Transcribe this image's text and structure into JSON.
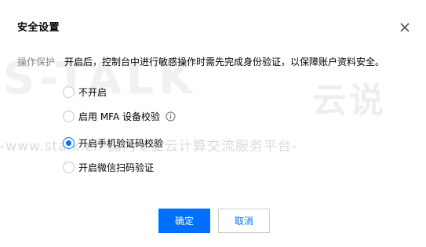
{
  "dialog": {
    "title": "安全设置",
    "close_icon": "close-icon"
  },
  "watermark": {
    "logo_text": "S-TALK",
    "brand_cn": "云说",
    "line": "-www.stalk.cn-国内专业云计算交流服务平台-"
  },
  "protection": {
    "label": "操作保护",
    "description": "开启后，控制台中进行敏感操作时需先完成身份验证，以保障账户资料安全。",
    "options": [
      {
        "label": "不开启",
        "selected": false
      },
      {
        "label": "启用 MFA 设备校验",
        "selected": false,
        "info_icon": "info-icon"
      },
      {
        "label": "开启手机验证码校验",
        "selected": true
      },
      {
        "label": "开启微信扫码验证",
        "selected": false
      }
    ]
  },
  "buttons": {
    "confirm": "确定",
    "cancel": "取消"
  },
  "colors": {
    "primary": "#006eff",
    "border": "#d0d0d0",
    "muted_label": "#888888"
  }
}
